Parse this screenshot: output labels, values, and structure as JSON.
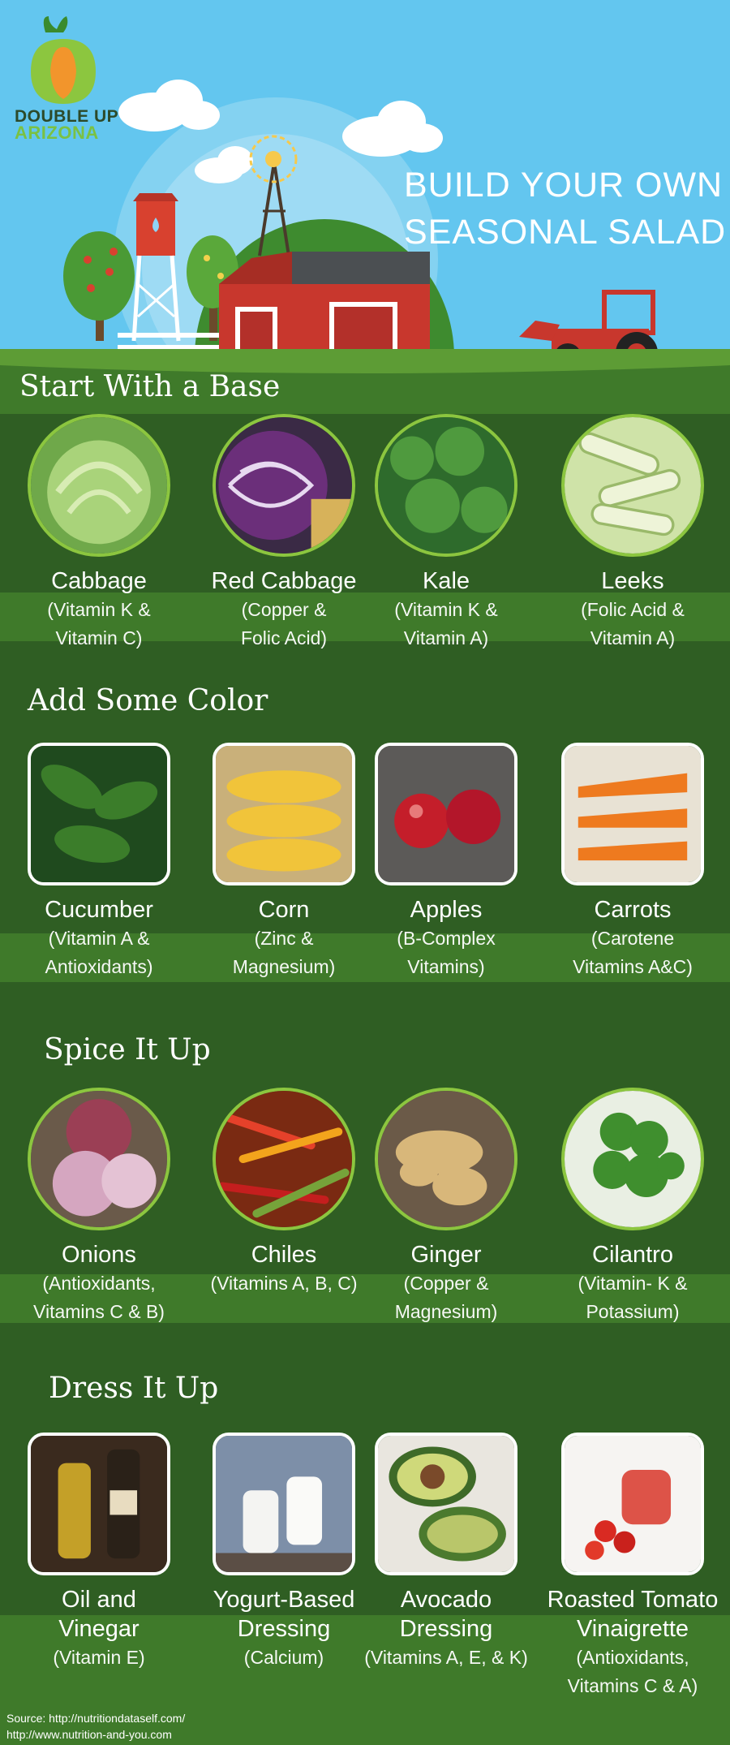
{
  "brand": {
    "logo_line1": "DOUBLE UP",
    "logo_line2": "ARIZONA"
  },
  "headline": {
    "line1": "BUILD YOUR OWN",
    "line2": "SEASONAL SALAD"
  },
  "sections": [
    {
      "title": "Start With a Base",
      "shape": "circle",
      "items": [
        {
          "name": "Cabbage",
          "nutrients": [
            "(Vitamin K &",
            "Vitamin C)"
          ],
          "icon": "cabbage-photo"
        },
        {
          "name": "Red Cabbage",
          "nutrients": [
            "(Copper &",
            "Folic Acid)"
          ],
          "icon": "red-cabbage-photo"
        },
        {
          "name": "Kale",
          "nutrients": [
            "(Vitamin K &",
            "Vitamin A)"
          ],
          "icon": "kale-photo"
        },
        {
          "name": "Leeks",
          "nutrients": [
            "(Folic Acid &",
            "Vitamin A)"
          ],
          "icon": "leeks-photo"
        }
      ]
    },
    {
      "title": "Add Some Color",
      "shape": "rounded",
      "items": [
        {
          "name": "Cucumber",
          "nutrients": [
            "(Vitamin A &",
            "Antioxidants)"
          ],
          "icon": "cucumber-photo"
        },
        {
          "name": "Corn",
          "nutrients": [
            "(Zinc &",
            "Magnesium)"
          ],
          "icon": "corn-photo"
        },
        {
          "name": "Apples",
          "nutrients": [
            "(B-Complex",
            "Vitamins)"
          ],
          "icon": "apples-photo"
        },
        {
          "name": "Carrots",
          "nutrients": [
            "(Carotene",
            "Vitamins A&C)"
          ],
          "icon": "carrots-photo"
        }
      ]
    },
    {
      "title": "Spice It Up",
      "shape": "circle",
      "items": [
        {
          "name": "Onions",
          "nutrients": [
            "(Antioxidants,",
            "Vitamins C & B)"
          ],
          "icon": "onions-photo"
        },
        {
          "name": "Chiles",
          "nutrients": [
            "(Vitamins A, B, C)"
          ],
          "icon": "chiles-photo"
        },
        {
          "name": "Ginger",
          "nutrients": [
            "(Copper &",
            "Magnesium)"
          ],
          "icon": "ginger-photo"
        },
        {
          "name": "Cilantro",
          "nutrients": [
            "(Vitamin- K &",
            "Potassium)"
          ],
          "icon": "cilantro-photo"
        }
      ]
    },
    {
      "title": "Dress It Up",
      "shape": "rounded",
      "items": [
        {
          "name": "Oil and Vinegar",
          "name_lines": [
            "Oil and",
            "Vinegar"
          ],
          "nutrients": [
            "(Vitamin E)"
          ],
          "icon": "oil-vinegar-photo"
        },
        {
          "name": "Yogurt-Based Dressing",
          "name_lines": [
            "Yogurt-Based",
            "Dressing"
          ],
          "nutrients": [
            "(Calcium)"
          ],
          "icon": "yogurt-dressing-photo"
        },
        {
          "name": "Avocado Dressing",
          "name_lines": [
            "Avocado",
            "Dressing"
          ],
          "nutrients": [
            "(Vitamins A, E, & K)"
          ],
          "icon": "avocado-dressing-photo"
        },
        {
          "name": "Roasted Tomato Vinaigrette",
          "name_lines": [
            "Roasted Tomato",
            "Vinaigrette"
          ],
          "nutrients": [
            "(Antioxidants,",
            "Vitamins C & A)"
          ],
          "icon": "tomato-vinaigrette-photo"
        }
      ]
    }
  ],
  "source": {
    "line1": "Source: http://nutritiondataself.com/",
    "line2": "http://www.nutrition-and-you.com"
  },
  "colors": {
    "sky": "#63c6ef",
    "grass_dark": "#2f5e23",
    "grass_light": "#4a8c2c",
    "accent_green": "#8cc63f",
    "barn_red": "#c8372d"
  }
}
